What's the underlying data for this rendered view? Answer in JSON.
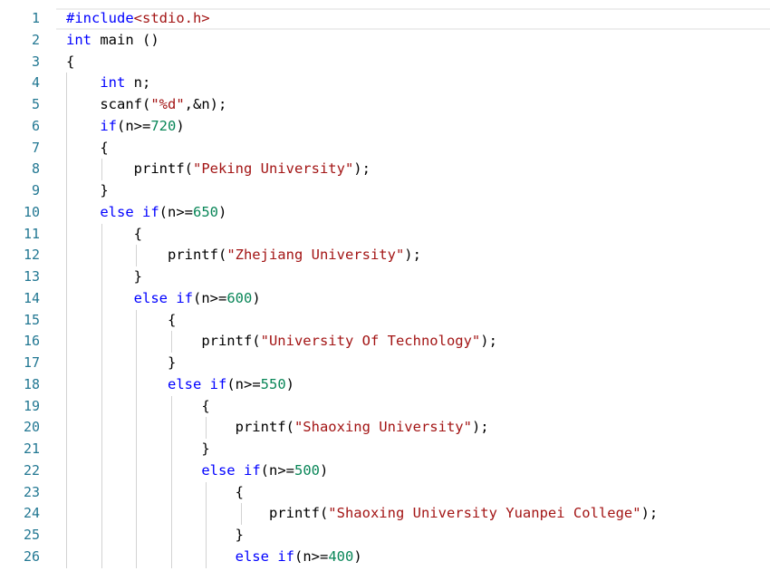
{
  "editor": {
    "line_numbers": [
      "1",
      "2",
      "3",
      "4",
      "5",
      "6",
      "7",
      "8",
      "9",
      "10",
      "11",
      "12",
      "13",
      "14",
      "15",
      "16",
      "17",
      "18",
      "19",
      "20",
      "21",
      "22",
      "23",
      "24",
      "25",
      "26"
    ],
    "colors": {
      "keyword": "#0000ff",
      "string": "#a31515",
      "number": "#098658",
      "line_number": "#237893"
    },
    "lines": [
      {
        "indent": "",
        "tokens": [
          {
            "t": "kw",
            "v": "#include"
          },
          {
            "t": "str",
            "v": "<stdio.h>"
          }
        ]
      },
      {
        "indent": "",
        "tokens": [
          {
            "t": "kw",
            "v": "int"
          },
          {
            "t": "plain",
            "v": " main ()"
          }
        ]
      },
      {
        "indent": "",
        "tokens": [
          {
            "t": "plain",
            "v": "{"
          }
        ]
      },
      {
        "indent": "    ",
        "tokens": [
          {
            "t": "kw",
            "v": "int"
          },
          {
            "t": "plain",
            "v": " n;"
          }
        ]
      },
      {
        "indent": "    ",
        "tokens": [
          {
            "t": "plain",
            "v": "scanf("
          },
          {
            "t": "str",
            "v": "\"%d\""
          },
          {
            "t": "plain",
            "v": ",&n);"
          }
        ]
      },
      {
        "indent": "    ",
        "tokens": [
          {
            "t": "kw",
            "v": "if"
          },
          {
            "t": "plain",
            "v": "(n>="
          },
          {
            "t": "num",
            "v": "720"
          },
          {
            "t": "plain",
            "v": ")"
          }
        ]
      },
      {
        "indent": "    ",
        "tokens": [
          {
            "t": "plain",
            "v": "{"
          }
        ]
      },
      {
        "indent": "        ",
        "tokens": [
          {
            "t": "plain",
            "v": "printf("
          },
          {
            "t": "str",
            "v": "\"Peking University\""
          },
          {
            "t": "plain",
            "v": ");"
          }
        ]
      },
      {
        "indent": "    ",
        "tokens": [
          {
            "t": "plain",
            "v": "}"
          }
        ]
      },
      {
        "indent": "    ",
        "tokens": [
          {
            "t": "kw",
            "v": "else"
          },
          {
            "t": "plain",
            "v": " "
          },
          {
            "t": "kw",
            "v": "if"
          },
          {
            "t": "plain",
            "v": "(n>="
          },
          {
            "t": "num",
            "v": "650"
          },
          {
            "t": "plain",
            "v": ")"
          }
        ]
      },
      {
        "indent": "        ",
        "tokens": [
          {
            "t": "plain",
            "v": "{"
          }
        ]
      },
      {
        "indent": "            ",
        "tokens": [
          {
            "t": "plain",
            "v": "printf("
          },
          {
            "t": "str",
            "v": "\"Zhejiang University\""
          },
          {
            "t": "plain",
            "v": ");"
          }
        ]
      },
      {
        "indent": "        ",
        "tokens": [
          {
            "t": "plain",
            "v": "}"
          }
        ]
      },
      {
        "indent": "        ",
        "tokens": [
          {
            "t": "kw",
            "v": "else"
          },
          {
            "t": "plain",
            "v": " "
          },
          {
            "t": "kw",
            "v": "if"
          },
          {
            "t": "plain",
            "v": "(n>="
          },
          {
            "t": "num",
            "v": "600"
          },
          {
            "t": "plain",
            "v": ")"
          }
        ]
      },
      {
        "indent": "            ",
        "tokens": [
          {
            "t": "plain",
            "v": "{"
          }
        ]
      },
      {
        "indent": "                ",
        "tokens": [
          {
            "t": "plain",
            "v": "printf("
          },
          {
            "t": "str",
            "v": "\"University Of Technology\""
          },
          {
            "t": "plain",
            "v": ");"
          }
        ]
      },
      {
        "indent": "            ",
        "tokens": [
          {
            "t": "plain",
            "v": "}"
          }
        ]
      },
      {
        "indent": "            ",
        "tokens": [
          {
            "t": "kw",
            "v": "else"
          },
          {
            "t": "plain",
            "v": " "
          },
          {
            "t": "kw",
            "v": "if"
          },
          {
            "t": "plain",
            "v": "(n>="
          },
          {
            "t": "num",
            "v": "550"
          },
          {
            "t": "plain",
            "v": ")"
          }
        ]
      },
      {
        "indent": "                ",
        "tokens": [
          {
            "t": "plain",
            "v": "{"
          }
        ]
      },
      {
        "indent": "                    ",
        "tokens": [
          {
            "t": "plain",
            "v": "printf("
          },
          {
            "t": "str",
            "v": "\"Shaoxing University\""
          },
          {
            "t": "plain",
            "v": ");"
          }
        ]
      },
      {
        "indent": "                ",
        "tokens": [
          {
            "t": "plain",
            "v": "}"
          }
        ]
      },
      {
        "indent": "                ",
        "tokens": [
          {
            "t": "kw",
            "v": "else"
          },
          {
            "t": "plain",
            "v": " "
          },
          {
            "t": "kw",
            "v": "if"
          },
          {
            "t": "plain",
            "v": "(n>="
          },
          {
            "t": "num",
            "v": "500"
          },
          {
            "t": "plain",
            "v": ")"
          }
        ]
      },
      {
        "indent": "                    ",
        "tokens": [
          {
            "t": "plain",
            "v": "{"
          }
        ]
      },
      {
        "indent": "                        ",
        "tokens": [
          {
            "t": "plain",
            "v": "printf("
          },
          {
            "t": "str",
            "v": "\"Shaoxing University Yuanpei College\""
          },
          {
            "t": "plain",
            "v": ");"
          }
        ]
      },
      {
        "indent": "                    ",
        "tokens": [
          {
            "t": "plain",
            "v": "}"
          }
        ]
      },
      {
        "indent": "                    ",
        "tokens": [
          {
            "t": "kw",
            "v": "else"
          },
          {
            "t": "plain",
            "v": " "
          },
          {
            "t": "kw",
            "v": "if"
          },
          {
            "t": "plain",
            "v": "(n>="
          },
          {
            "t": "num",
            "v": "400"
          },
          {
            "t": "plain",
            "v": ")"
          }
        ]
      }
    ]
  }
}
